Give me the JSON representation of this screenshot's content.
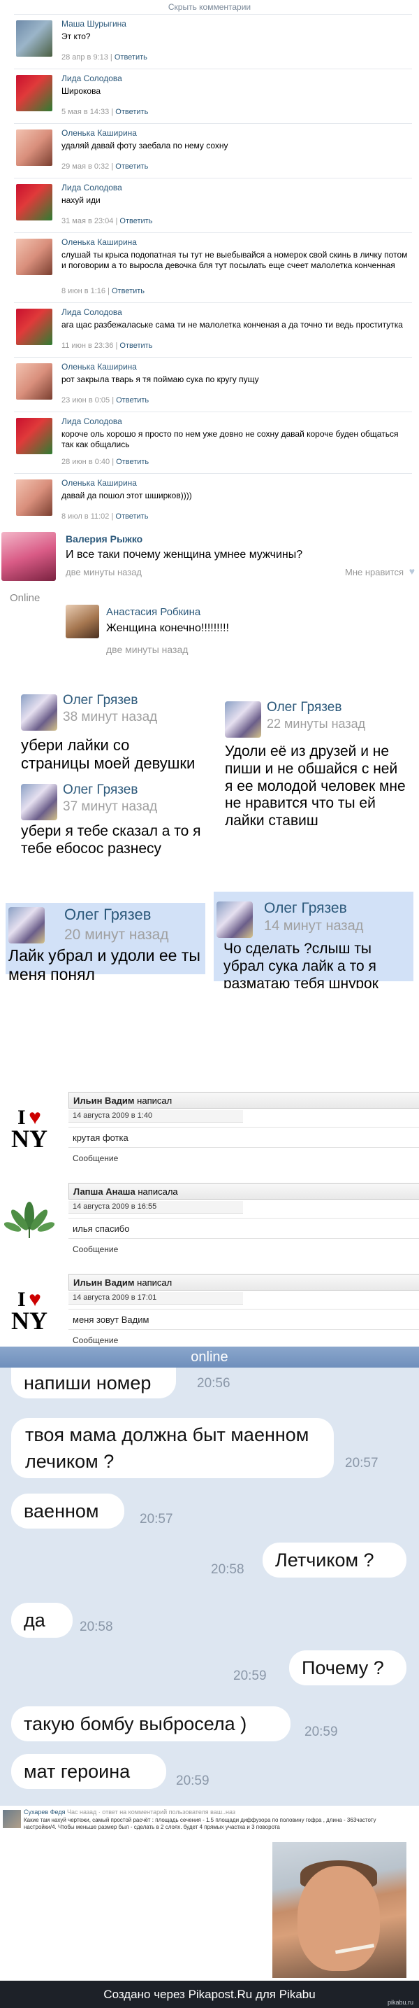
{
  "header": {
    "hide_comments": "Скрыть комментарии"
  },
  "comments": [
    {
      "name": "Маша Шурыгина",
      "text": "Эт кто?",
      "time": "28 апр в 9:13",
      "reply": "Ответить"
    },
    {
      "name": "Лида Солодова",
      "text": "Широкова",
      "time": "5 мая в 14:33",
      "reply": "Ответить"
    },
    {
      "name": "Оленька Каширина",
      "text": "удаляй давай фоту заебала по нему сохну",
      "time": "29 мая в 0:32",
      "reply": "Ответить"
    },
    {
      "name": "Лида Солодова",
      "text": "нахуй иди",
      "time": "31 мая в 23:04",
      "reply": "Ответить"
    },
    {
      "name": "Оленька Каширина",
      "text": "слушай ты крыса подопатная ты тут не выебывайся а номерок свой скинь в личку потом и поговорим а то выросла девочка бля тут посылать еще счеет малолетка конченная",
      "time": "8 июн в 1:16",
      "reply": "Ответить"
    },
    {
      "name": "Лида Солодова",
      "text": "ага щас разбежалаське сама ти не малолетка конченая а да точно ти ведь проститутка",
      "time": "11 июн в 23:36",
      "reply": "Ответить"
    },
    {
      "name": "Оленька Каширина",
      "text": "рот закрыла тварь я тя поймаю сука по кругу пущу",
      "time": "23 июн в 0:05",
      "reply": "Ответить"
    },
    {
      "name": "Лида Солодова",
      "text": "короче оль хорошо я просто по нем уже довно не сохну давай короче буден общаться так как общались",
      "time": "28 июн в 0:40",
      "reply": "Ответить"
    },
    {
      "name": "Оленька Каширина",
      "text": "давай да пошол этот шширков))))",
      "time": "8 июл в 11:02",
      "reply": "Ответить"
    }
  ],
  "valeria": {
    "name": "Валерия Рыжко",
    "text": "И все таки почему женщина умнее мужчины?",
    "time": "две минуты назад",
    "like": "Мне нравится",
    "online": "Online"
  },
  "anastasia": {
    "name": "Анастасия Робкина",
    "text": "Женщина конечно!!!!!!!!!",
    "time": "две минуты назад"
  },
  "oleg": [
    {
      "name": "Олег Грязев",
      "time": "38 минут назад",
      "text": "убери лайки со страницы моей девушки"
    },
    {
      "name": "Олег Грязев",
      "time": "22 минуты назад",
      "text": "Удоли её из друзей и не пиши и не обшайся с ней я ее молодой человек мне не нравится что ты ей лайки ставиш"
    },
    {
      "name": "Олег Грязев",
      "time": "37 минут назад",
      "text": "убери я тебе сказал а то я тебе ебосос разнесу"
    },
    {
      "name": "Олег Грязев",
      "time": "20 минут назад",
      "text": "Лайк убрал и удоли ее ты меня понял"
    },
    {
      "name": "Олег Грязев",
      "time": "14 минут назад",
      "text": "Чо сделать ?слыш ты убрал сука лайк а то я разматаю тебя шнурок"
    }
  ],
  "ilyin": [
    {
      "author": "Ильин Вадим",
      "action": "написал",
      "date": "14 августа 2009 в 1:40",
      "text": "крутая фотка",
      "link": "Сообщение",
      "icon": "i-love-ny-icon",
      "icon_text": [
        "I",
        "♥",
        "NY"
      ]
    },
    {
      "author": "Лапша Анаша",
      "action": "написала",
      "date": "14 августа 2009 в 16:55",
      "text": "илья спасибо",
      "link": "Сообщение",
      "icon": "cannabis-leaf-icon"
    },
    {
      "author": "Ильин Вадим",
      "action": "написал",
      "date": "14 августа 2009 в 17:01",
      "text": "меня зовут Вадим",
      "link": "Сообщение",
      "icon": "i-love-ny-icon",
      "icon_text": [
        "I",
        "♥",
        "NY"
      ]
    }
  ],
  "chat": {
    "status": "online",
    "messages": [
      {
        "text": "напиши номер",
        "time": "20:56",
        "side": "left"
      },
      {
        "text": "твоя мама должна быт маенном лечиком ?",
        "time": "20:57",
        "side": "left"
      },
      {
        "text": "ваенном",
        "time": "20:57",
        "side": "left"
      },
      {
        "text": "Летчиком ?",
        "time": "20:58",
        "side": "right"
      },
      {
        "text": "да",
        "time": "20:58",
        "side": "left"
      },
      {
        "text": "Почему ?",
        "time": "20:59",
        "side": "right"
      },
      {
        "text": "такую бомбу выбросела )",
        "time": "20:59",
        "side": "left"
      },
      {
        "text": "мат героина",
        "time": "20:59",
        "side": "left"
      }
    ]
  },
  "suharev": {
    "name": "Сухарев Федя",
    "subtitle": "Час назад · ответ на комментарий пользователя ваш..наз",
    "text": "Какие там нахуй чертежи, самый простой расчёт : площадь сечения - 1.5 площади диффузора по половину гофра , длина - 363частоту настройки/4. Чтобы меньше размер был - сделать в 2 слоях. будет 4 прямых участка и 3 поворота"
  },
  "footer": {
    "text": "Создано через Pikapost.Ru для Pikabu",
    "logo": "pikabu.ru"
  },
  "colors": {
    "link": "#2b587a",
    "chat_bg": "#dde6f1",
    "chat_header": "#7895c1",
    "oleg_highlight": "#d2e1f7",
    "footer_bg": "#1d2128"
  }
}
